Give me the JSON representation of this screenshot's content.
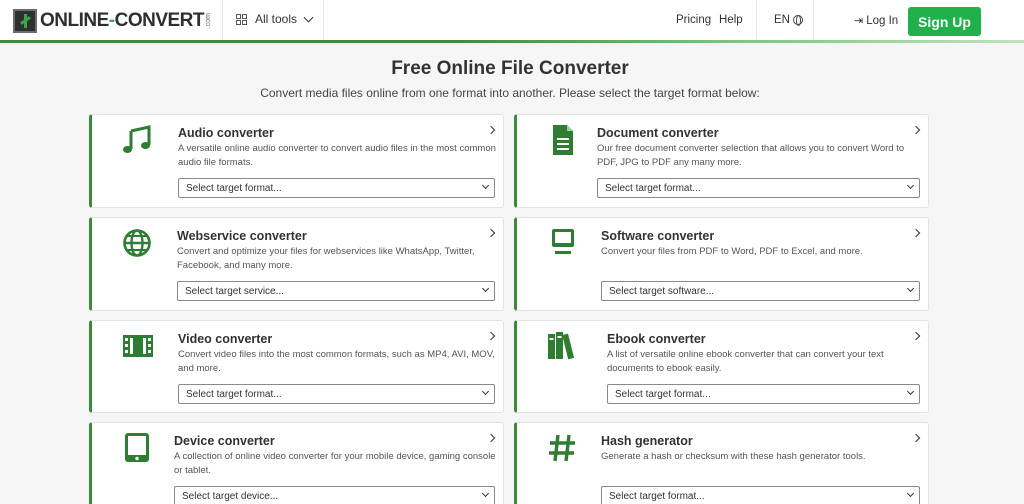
{
  "header": {
    "logo_text_a": "ONLINE",
    "logo_text_dash": "-",
    "logo_text_b": "CONVERT",
    "logo_com": ".com",
    "all_tools": "All tools",
    "pricing": "Pricing",
    "help": "Help",
    "language": "EN",
    "login": "Log In",
    "signup": "Sign Up"
  },
  "intro": {
    "title": "Free Online File Converter",
    "subtitle": "Convert media files online from one format into another. Please select the target format below:"
  },
  "colors": {
    "accent": "#21b14b",
    "icon_green": "#2e7d32",
    "border_green": "#3a8a3a"
  },
  "cards": [
    {
      "icon": "music-note-icon",
      "title": "Audio converter",
      "desc": "A versatile online audio converter to convert audio files in the most common audio file formats.",
      "select": "Select target format..."
    },
    {
      "icon": "document-icon",
      "title": "Document converter",
      "desc": "Our free document converter selection that allows you to convert Word to PDF, JPG to PDF any many more.",
      "select": "Select target format..."
    },
    {
      "icon": "globe-icon",
      "title": "Webservice converter",
      "desc": "Convert and optimize your files for webservices like WhatsApp, Twitter, Facebook, and many more.",
      "select": "Select target service..."
    },
    {
      "icon": "monitor-icon",
      "title": "Software converter",
      "desc": "Convert your files from PDF to Word, PDF to Excel, and more.",
      "select": "Select target software..."
    },
    {
      "icon": "film-icon",
      "title": "Video converter",
      "desc": "Convert video files into the most common formats, such as MP4, AVI, MOV, and more.",
      "select": "Select target format..."
    },
    {
      "icon": "books-icon",
      "title": "Ebook converter",
      "desc": "A list of versatile online ebook converter that can convert your text documents to ebook easily.",
      "select": "Select target format..."
    },
    {
      "icon": "tablet-icon",
      "title": "Device converter",
      "desc": "A collection of online video converter for your mobile device, gaming console or tablet.",
      "select": "Select target device..."
    },
    {
      "icon": "hash-icon",
      "title": "Hash generator",
      "desc": "Generate a hash or checksum with these hash generator tools.",
      "select": "Select target format..."
    }
  ]
}
